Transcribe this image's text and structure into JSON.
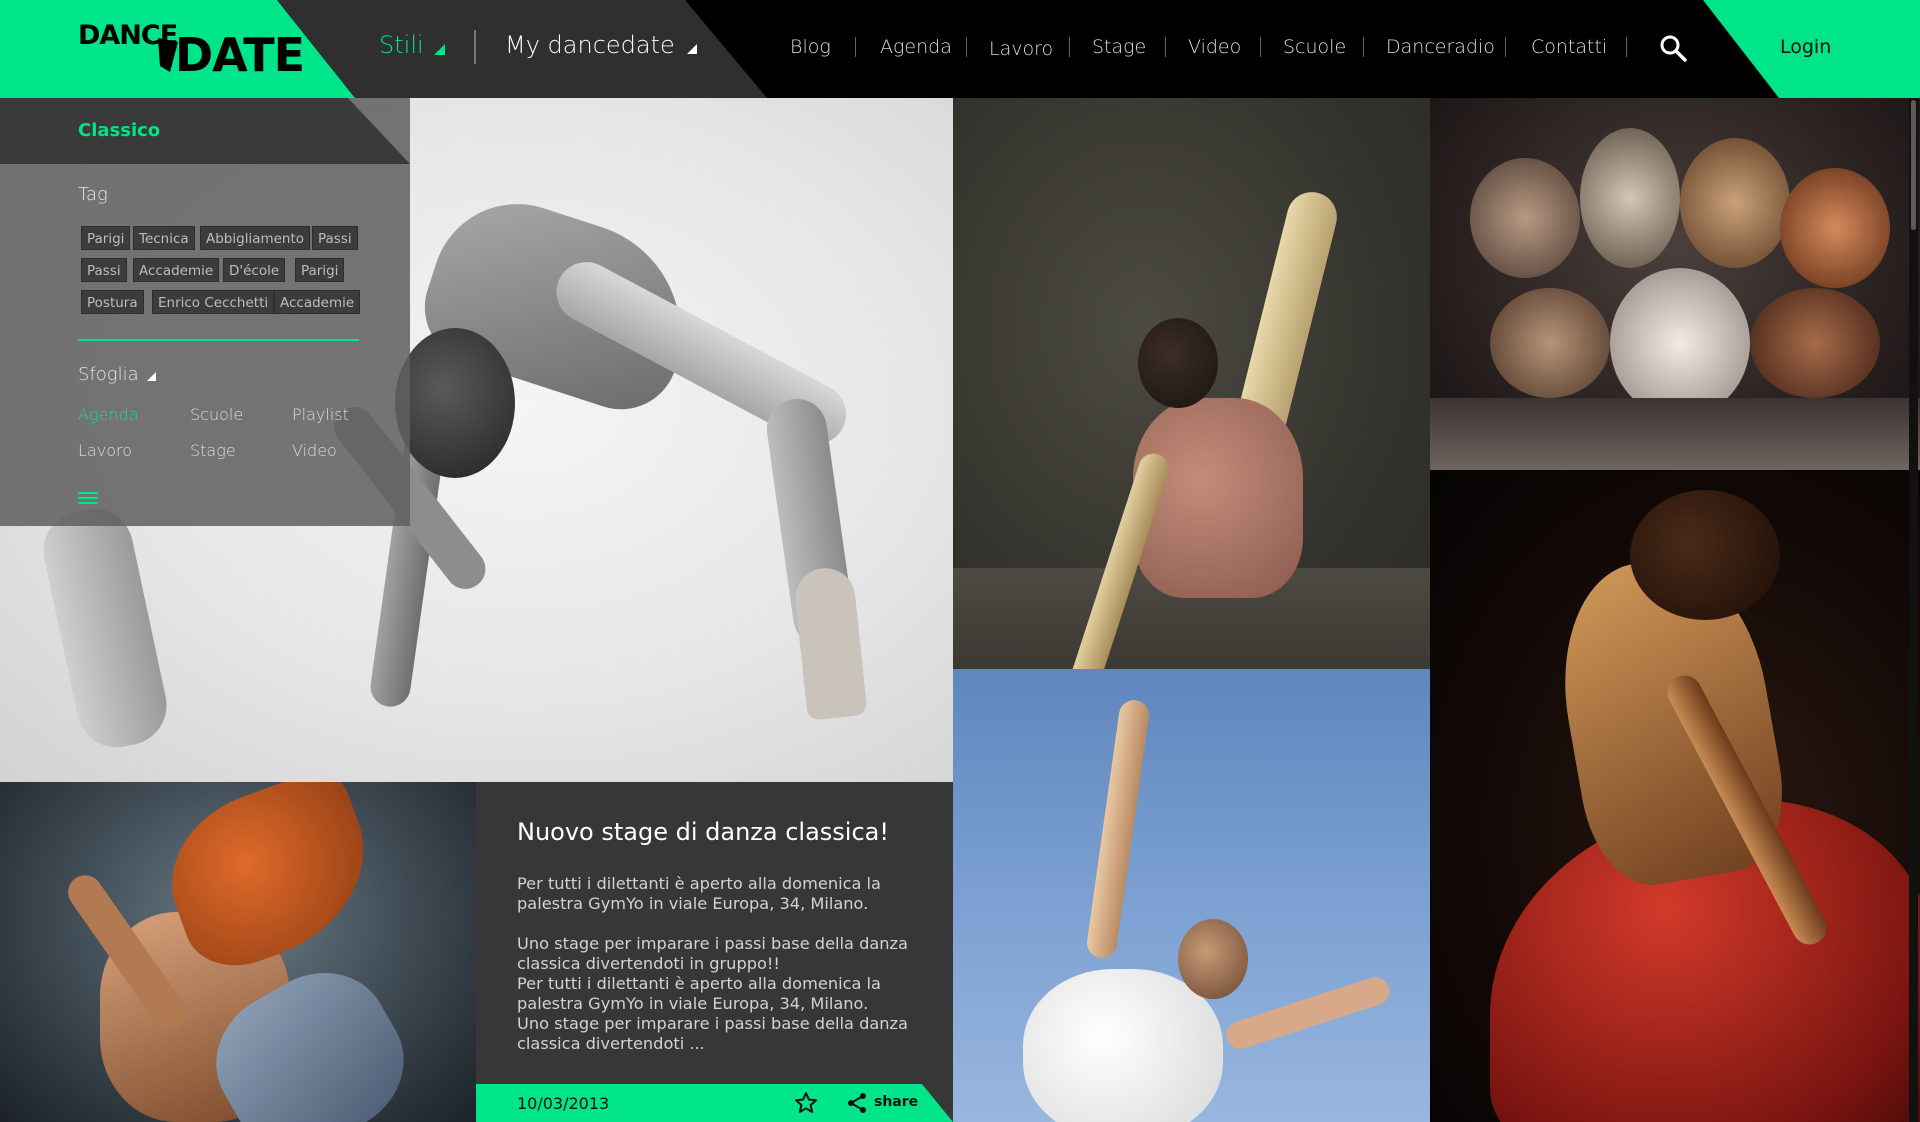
{
  "header": {
    "logo_small": "DANCE",
    "logo_big": "DATE",
    "stili": "Stili",
    "my_dancedate": "My dancedate",
    "nav": [
      "Blog",
      "Agenda",
      "Lavoro",
      "Stage",
      "Video",
      "Scuole",
      "Danceradio",
      "Contatti"
    ],
    "login": "Login",
    "accent_color": "#00e58a"
  },
  "panel": {
    "title": "Classico",
    "tag_heading": "Tag",
    "tags": [
      "Parigi",
      "Tecnica",
      "Abbigliamento",
      "Passi",
      "Passi",
      "Accademie",
      "D'école",
      "Parigi",
      "Postura",
      "Enrico Cecchetti",
      "Accademie"
    ],
    "browse_heading": "Sfoglia",
    "browse": [
      "Agenda",
      "Scuole",
      "Playlist",
      "Lavoro",
      "Stage",
      "Video"
    ],
    "browse_active": "Agenda",
    "menu_icon": "hamburger-icon"
  },
  "article": {
    "title": "Nuovo stage di danza classica!",
    "body": "Per tutti i dilettanti è aperto alla domenica la palestra GymYo in viale Europa, 34, Milano.\n\nUno stage per imparare i passi base della danza classica divertendoti in gruppo!!\nPer tutti i dilettanti è aperto alla domenica la palestra GymYo in viale Europa, 34, Milano.\nUno stage per imparare i passi base della danza classica divertendoti ...",
    "date": "10/03/2013",
    "share": "share",
    "icons": [
      "star-icon",
      "share-icon"
    ]
  },
  "images": [
    "hero-ballerina",
    "ballet-seated",
    "cats-musical",
    "flamenco-dancer",
    "hair-dancer",
    "ballet-leap"
  ]
}
